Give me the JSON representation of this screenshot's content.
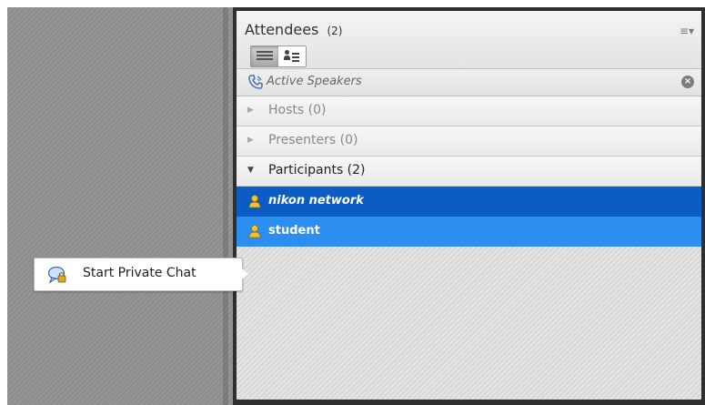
{
  "pod": {
    "title": "Attendees",
    "count": "(2)",
    "menu_icon": "menu-lines-icon",
    "view_buttons": [
      {
        "name": "list-view",
        "icon": "list-view-icon",
        "active": true
      },
      {
        "name": "card-view",
        "icon": "user-card-icon",
        "active": false
      }
    ]
  },
  "speakers": {
    "label": "Active Speakers",
    "icon": "phone-icon",
    "close_icon": "close-circle-icon"
  },
  "groups": [
    {
      "label": "Hosts (0)",
      "expanded": false
    },
    {
      "label": "Presenters (0)",
      "expanded": false
    },
    {
      "label": "Participants (2)",
      "expanded": true
    }
  ],
  "participants": [
    {
      "name": "nikon network",
      "selected": "primary"
    },
    {
      "name": "student",
      "selected": "secondary"
    }
  ],
  "context_action": {
    "label": "Start Private Chat",
    "icon": "private-chat-icon"
  },
  "colors": {
    "selected_dark": "#0b5cc4",
    "selected_light": "#2b8ef0",
    "user_icon": "#f2c230"
  }
}
